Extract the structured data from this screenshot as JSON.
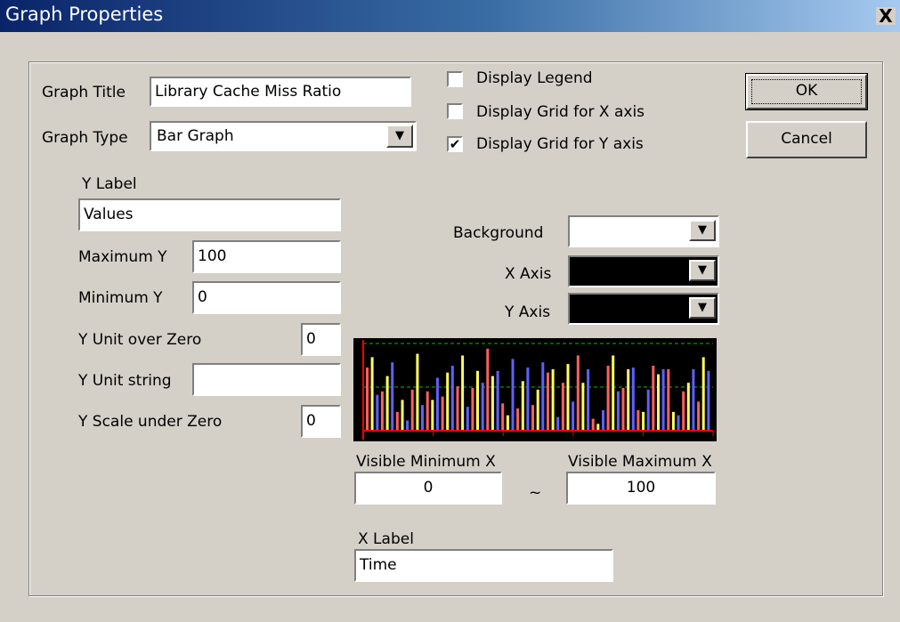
{
  "window": {
    "title": "Graph Properties",
    "close_label": "X"
  },
  "form": {
    "graph_title_label": "Graph Title",
    "graph_title_value": "Library Cache Miss Ratio",
    "graph_type_label": "Graph Type",
    "graph_type_value": "Bar Graph",
    "y_label_label": "Y Label",
    "y_label_value": "Values",
    "max_y_label": "Maximum Y",
    "max_y_value": "100",
    "min_y_label": "Minimum Y",
    "min_y_value": "0",
    "y_unit_over_zero_label": "Y Unit over Zero",
    "y_unit_over_zero_value": "0",
    "y_unit_string_label": "Y Unit string",
    "y_unit_string_value": "",
    "y_scale_under_zero_label": "Y Scale under Zero",
    "y_scale_under_zero_value": "0"
  },
  "options": {
    "display_legend": {
      "label": "Display Legend",
      "checked": false
    },
    "display_grid_x": {
      "label": "Display Grid for X axis",
      "checked": false
    },
    "display_grid_y": {
      "label": "Display Grid for Y axis",
      "checked": true
    },
    "check_mark": "✔"
  },
  "colors": {
    "background_label": "Background",
    "background_color": "#ffffff",
    "x_axis_label": "X Axis",
    "x_axis_color": "#000000",
    "y_axis_label": "Y Axis",
    "y_axis_color": "#000000",
    "preview_bg": "#000000",
    "preview_axis": "#ff0000",
    "preview_grid": "#00c000",
    "bar_colors": [
      "#ff6060",
      "#ffff60",
      "#6060ff"
    ]
  },
  "dropdown_arrow": "▼",
  "range": {
    "min_label": "Visible Minimum X",
    "min_value": "0",
    "separator": "~",
    "max_label": "Visible Maximum X",
    "max_value": "100"
  },
  "x_label": {
    "label": "X Label",
    "value": "Time"
  },
  "buttons": {
    "ok": "OK",
    "cancel": "Cancel"
  },
  "preview_bars": [
    0.74,
    0.86,
    0.42,
    0.46,
    0.64,
    0.8,
    0.22,
    0.36,
    0.12,
    0.48,
    0.9,
    0.3,
    0.46,
    0.36,
    0.62,
    0.4,
    0.68,
    0.76,
    0.52,
    0.88,
    0.28,
    0.5,
    0.7,
    0.56,
    0.96,
    0.64,
    0.7,
    0.32,
    0.18,
    0.84,
    0.26,
    0.58,
    0.74,
    0.3,
    0.48,
    0.8,
    0.68,
    0.72,
    0.16,
    0.56,
    0.78,
    0.34,
    0.88,
    0.56,
    0.72,
    0.14,
    0.08,
    0.24,
    0.76,
    0.88,
    0.46,
    0.5,
    0.72,
    0.74,
    0.24,
    0.22,
    0.48,
    0.76,
    0.66,
    0.72,
    0.72,
    0.22,
    0.18,
    0.46,
    0.56,
    0.72,
    0.34,
    0.86,
    0.7
  ]
}
